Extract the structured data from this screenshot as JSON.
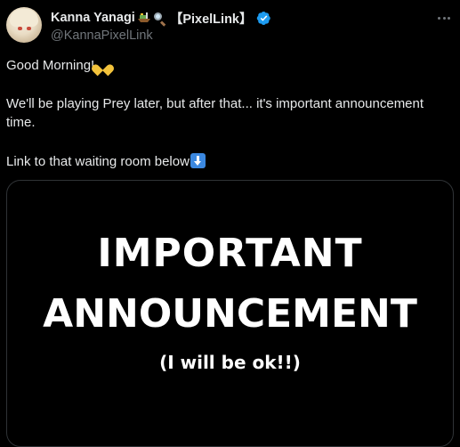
{
  "author": {
    "display_name": "Kanna Yanagi",
    "org": "【PixelLink】",
    "handle": "@KannaPixelLink",
    "emoji_1": "boat-icon",
    "emoji_2": "magnifier-icon",
    "verified": true
  },
  "tweet": {
    "line1": "Good Morning!",
    "line2": "We'll be playing Prey later, but after that... it's important announcement time.",
    "line3": "Link to that waiting room below"
  },
  "media": {
    "line1": "IMPORTANT",
    "line2": "ANNOUNCEMENT",
    "line3": "(I will be ok!!)"
  },
  "colors": {
    "background": "#000000",
    "text": "#e7e9ea",
    "secondary_text": "#71767b",
    "verified_badge": "#1d9bf0",
    "border": "#2f3336"
  },
  "icons": {
    "more": "more-options-icon",
    "heart_hands": "heart-hands-emoji-icon",
    "down_arrow": "down-arrow-emoji-icon"
  }
}
